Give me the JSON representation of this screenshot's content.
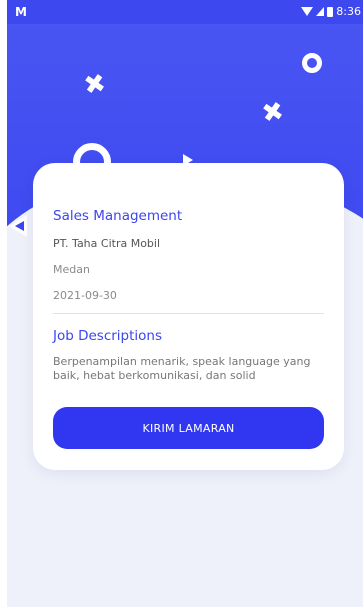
{
  "statusbar": {
    "left_icon": "M",
    "time": "8:36"
  },
  "job": {
    "title": "Sales Management",
    "company": "PT. Taha Citra Mobil",
    "city": "Medan",
    "date": "2021-09-30",
    "description_heading": "Job Descriptions",
    "description": "Berpenampilan menarik, speak language yang baik, hebat berkomunikasi, dan solid"
  },
  "actions": {
    "apply_label": "KIRIM LAMARAN"
  },
  "colors": {
    "primary": "#3b46f0",
    "background": "#eef1fa",
    "card": "#ffffff"
  }
}
